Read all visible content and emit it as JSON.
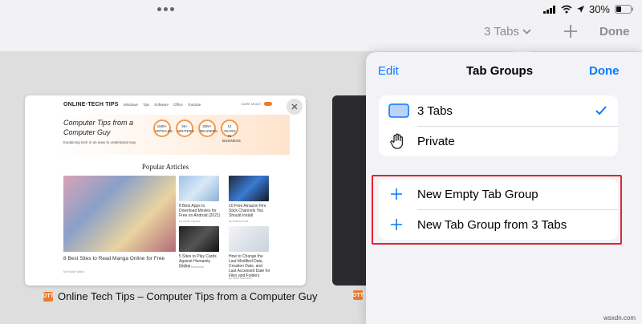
{
  "status": {
    "battery": "30%"
  },
  "toolbar": {
    "tabs_label": "3 Tabs",
    "done_label": "Done"
  },
  "card": {
    "logo_prefix": "ONLINE",
    "logo_suffix": "TECH TIPS",
    "menu": [
      "Windows",
      "Tips",
      "Software",
      "Office",
      "Youtube"
    ],
    "mode": "DARK MODE",
    "hero_title": "Computer Tips from a Computer Guy",
    "hero_sub": "Explaining tech in an easy to understand way",
    "badges": [
      "1800+ ARTICLES",
      "35+ WRITERS",
      "30M+ READERS",
      "14 YEARS IN BUSINESS"
    ],
    "popular": "Popular Articles",
    "articles": [
      {
        "title": "8 Best Sites to Read Manga Online for Free",
        "meta": "by Krystle Walsh"
      },
      {
        "title": "8 Best Apps to Download Movies for Free on Android (2021)",
        "meta": "by Jonas Gaurav"
      },
      {
        "title": "10 Free Amazon Fire Stick Channels You Should Install",
        "meta": "by Joshua Goel"
      },
      {
        "title": "5 Sites to Play Cards Against Humanity Online",
        "meta": "by Sarah Boubrahia"
      },
      {
        "title": "How to Change the Last Modified Date, Creation Date, and Last Accessed Date for Files and Folders",
        "meta": "by Sean Saunders"
      }
    ],
    "caption": "Online Tech Tips – Computer Tips from a Computer Guy"
  },
  "popover": {
    "edit": "Edit",
    "title": "Tab Groups",
    "done": "Done",
    "groups": [
      {
        "label": "3 Tabs",
        "icon": "tab-group-icon",
        "selected": true
      },
      {
        "label": "Private",
        "icon": "hand-icon",
        "selected": false
      }
    ],
    "actions": [
      {
        "label": "New Empty Tab Group",
        "icon": "plus-icon"
      },
      {
        "label": "New Tab Group from 3 Tabs",
        "icon": "plus-icon"
      }
    ],
    "highlight_color": "#e4222c",
    "accent": "#0a7aff"
  },
  "watermark": "wsxdn.com"
}
